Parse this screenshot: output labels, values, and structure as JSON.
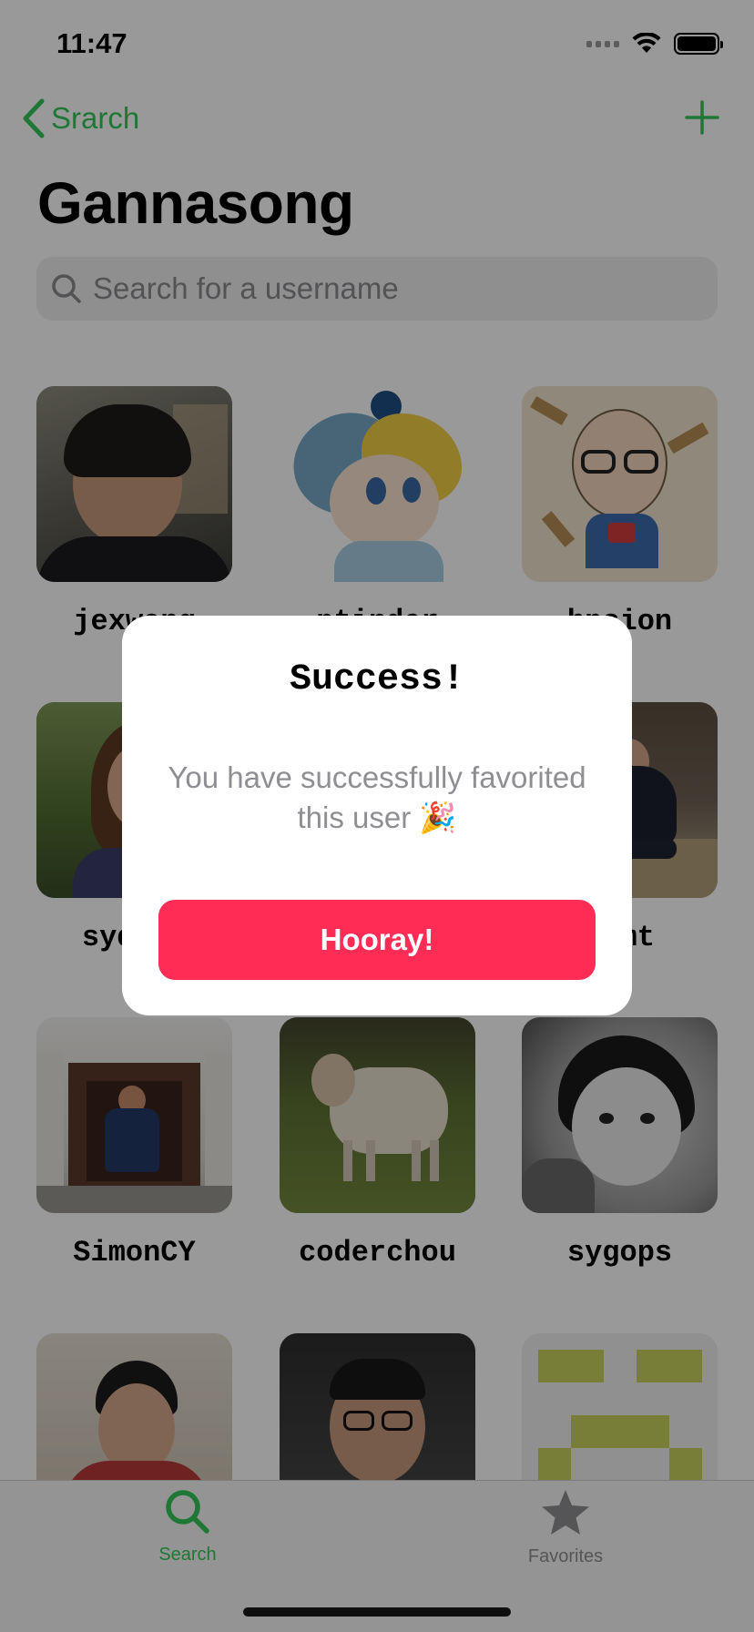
{
  "status": {
    "time": "11:47"
  },
  "nav": {
    "back_label": "Srarch",
    "title": "Gannasong"
  },
  "search": {
    "placeholder": "Search for a username"
  },
  "users": [
    {
      "name": "jexwang"
    },
    {
      "name": "ptinder"
    },
    {
      "name": "hpsion"
    },
    {
      "name": "sydney"
    },
    {
      "name": ""
    },
    {
      "name": "ksmt"
    },
    {
      "name": "SimonCY"
    },
    {
      "name": "coderchou"
    },
    {
      "name": "sygops"
    },
    {
      "name": ""
    },
    {
      "name": ""
    },
    {
      "name": ""
    }
  ],
  "tabs": [
    {
      "label": "Search",
      "icon": "search-icon",
      "active": true
    },
    {
      "label": "Favorites",
      "icon": "star-icon",
      "active": false
    }
  ],
  "alert": {
    "title": "Success!",
    "message": "You have successfully favorited this user 🎉",
    "button": "Hooray!"
  },
  "colors": {
    "accent": "#34c759",
    "alert_button": "#ff2d55"
  }
}
